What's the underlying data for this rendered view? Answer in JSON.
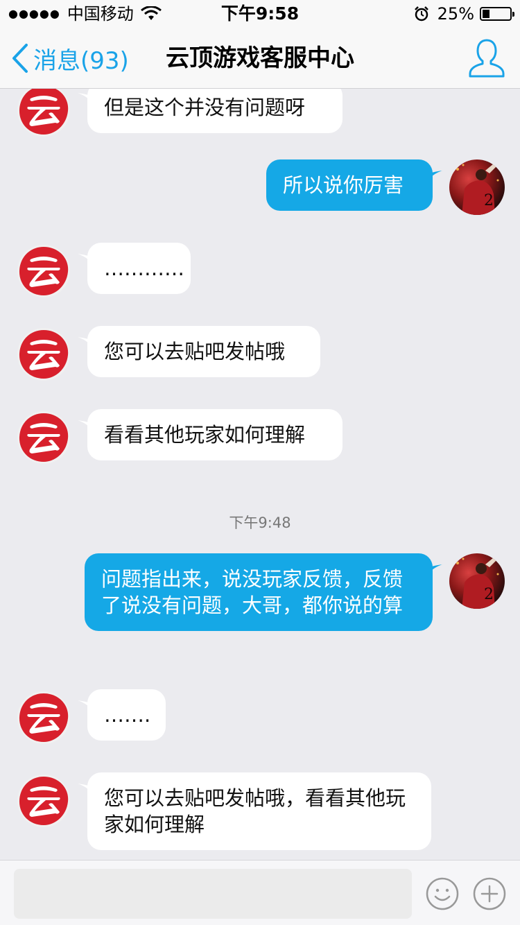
{
  "status_bar": {
    "signal_dots": "●●●●●",
    "carrier": "中国移动",
    "time": "下午9:58",
    "battery_percent_text": "25%",
    "battery_level": 0.25
  },
  "nav": {
    "back_label": "消息(93)",
    "title": "云顶游戏客服中心",
    "accent_color": "#1aa3e8"
  },
  "messages": [
    {
      "side": "in",
      "text": "但是这个并没有问题呀"
    },
    {
      "side": "out",
      "text": "所以说你厉害"
    },
    {
      "side": "in",
      "text": "…………"
    },
    {
      "side": "in",
      "text": "您可以去贴吧发帖哦"
    },
    {
      "side": "in",
      "text": "看看其他玩家如何理解"
    },
    {
      "side": "time",
      "text": "下午9:48"
    },
    {
      "side": "out",
      "text": "问题指出来，说没玩家反馈，反馈了说没有问题，大哥，都你说的算"
    },
    {
      "side": "in",
      "text": "……."
    },
    {
      "side": "in",
      "text": "您可以去贴吧发帖哦，看看其他玩家如何理解"
    }
  ],
  "input": {
    "placeholder": ""
  },
  "icons": {
    "back": "chevron-left-icon",
    "profile": "person-icon",
    "emoji": "smiley-icon",
    "more": "plus-circle-icon",
    "service_avatar": "yunding-logo-icon"
  },
  "colors": {
    "outgoing_bubble": "#15a8e6",
    "incoming_bubble": "#ffffff",
    "background": "#ebebef",
    "logo_red": "#d8202c"
  }
}
